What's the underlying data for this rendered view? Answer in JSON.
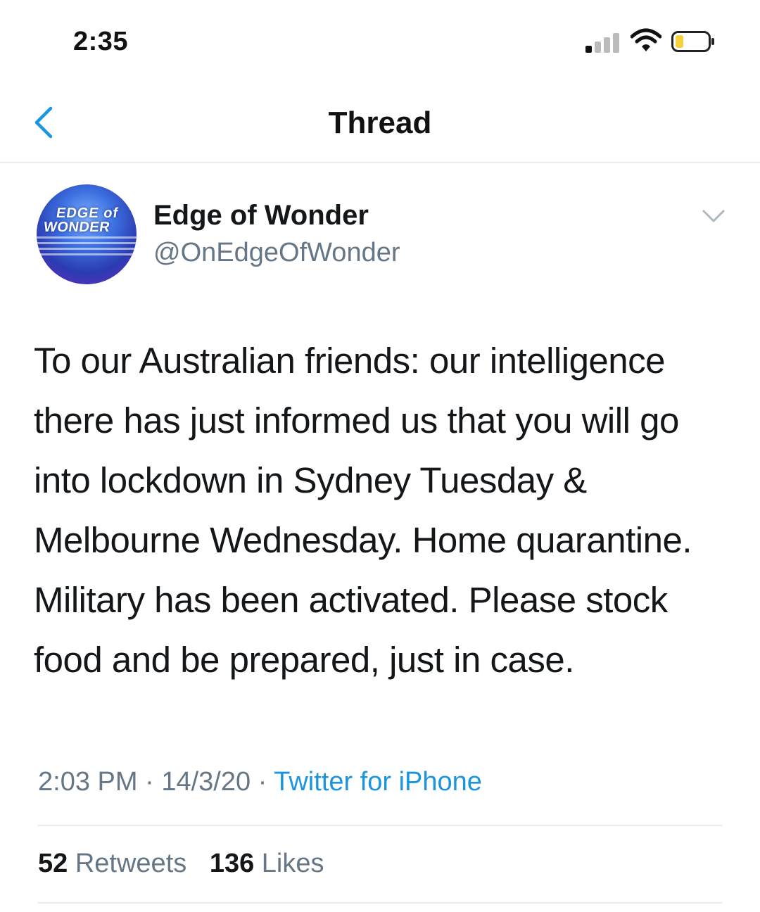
{
  "status_bar": {
    "time": "2:35",
    "signal_icon": "cellular-signal-icon",
    "wifi_icon": "wifi-icon",
    "battery_icon": "battery-low-icon",
    "battery_color": "#f5d13b"
  },
  "nav": {
    "back_icon": "chevron-left-icon",
    "title": "Thread"
  },
  "tweet": {
    "avatar": {
      "logo_line1": "EDGE of",
      "logo_line2": "WONDER"
    },
    "display_name": "Edge of Wonder",
    "handle": "@OnEdgeOfWonder",
    "more_icon": "chevron-down-icon",
    "text": "To our Australian friends: our intelligence there has just informed us that you will go into lockdown in Sydney Tuesday & Melbourne Wednesday. Home quarantine. Military has been activated. Please stock food and be prepared, just in case.",
    "time": "2:03 PM",
    "date": "14/3/20",
    "separator": "·",
    "source": "Twitter for iPhone",
    "retweets_count": "52",
    "retweets_label": "Retweets",
    "likes_count": "136",
    "likes_label": "Likes"
  },
  "colors": {
    "link": "#1b95e0",
    "secondary_text": "#657786",
    "primary_text": "#14171a",
    "divider": "#e6ecf0"
  }
}
